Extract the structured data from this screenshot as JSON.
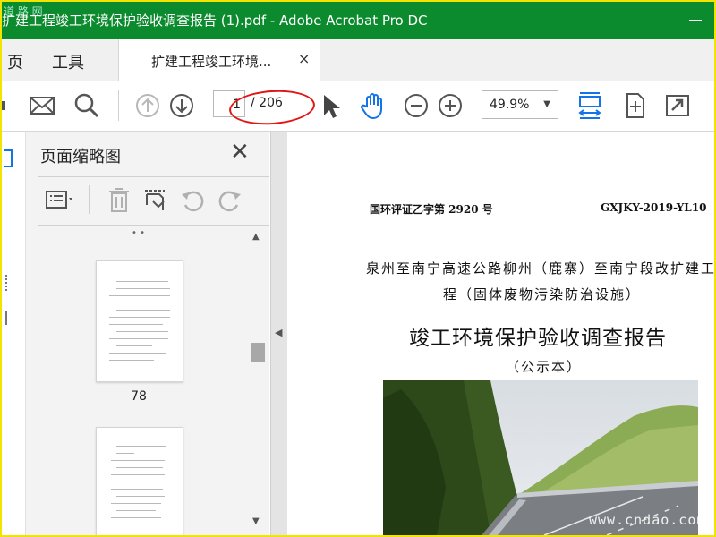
{
  "window": {
    "title": "扩建工程竣工环境保护验收调查报告 (1).pdf - Adobe Acrobat Pro DC",
    "watermark_top": "道 路 网"
  },
  "menu": {
    "home": "页",
    "tools": "工具"
  },
  "tab": {
    "label": "扩建工程竣工环境...",
    "close": "×"
  },
  "toolbar": {
    "current_page": "1",
    "page_total": "/ 206",
    "zoom": "49.9%"
  },
  "thumbnails_panel": {
    "title": "页面缩略图",
    "pages": [
      {
        "number": "78"
      },
      {
        "number": ""
      }
    ]
  },
  "document": {
    "header_left": "国环评证乙字第 2920 号",
    "header_right": "GXJKY-2019-YL10",
    "subtitle_line1": "泉州至南宁高速公路柳州（鹿寨）至南宁段改扩建工",
    "subtitle_line2": "程（固体废物污染防治设施）",
    "title": "竣工环境保护验收调查报告",
    "note": "（公示本）"
  },
  "watermark_bottom": "www.cndao.com",
  "colors": {
    "titlebar": "#0b8b2e",
    "accent_blue": "#1473e6",
    "annotation_red": "#e01515",
    "frame": "#f2e300"
  }
}
